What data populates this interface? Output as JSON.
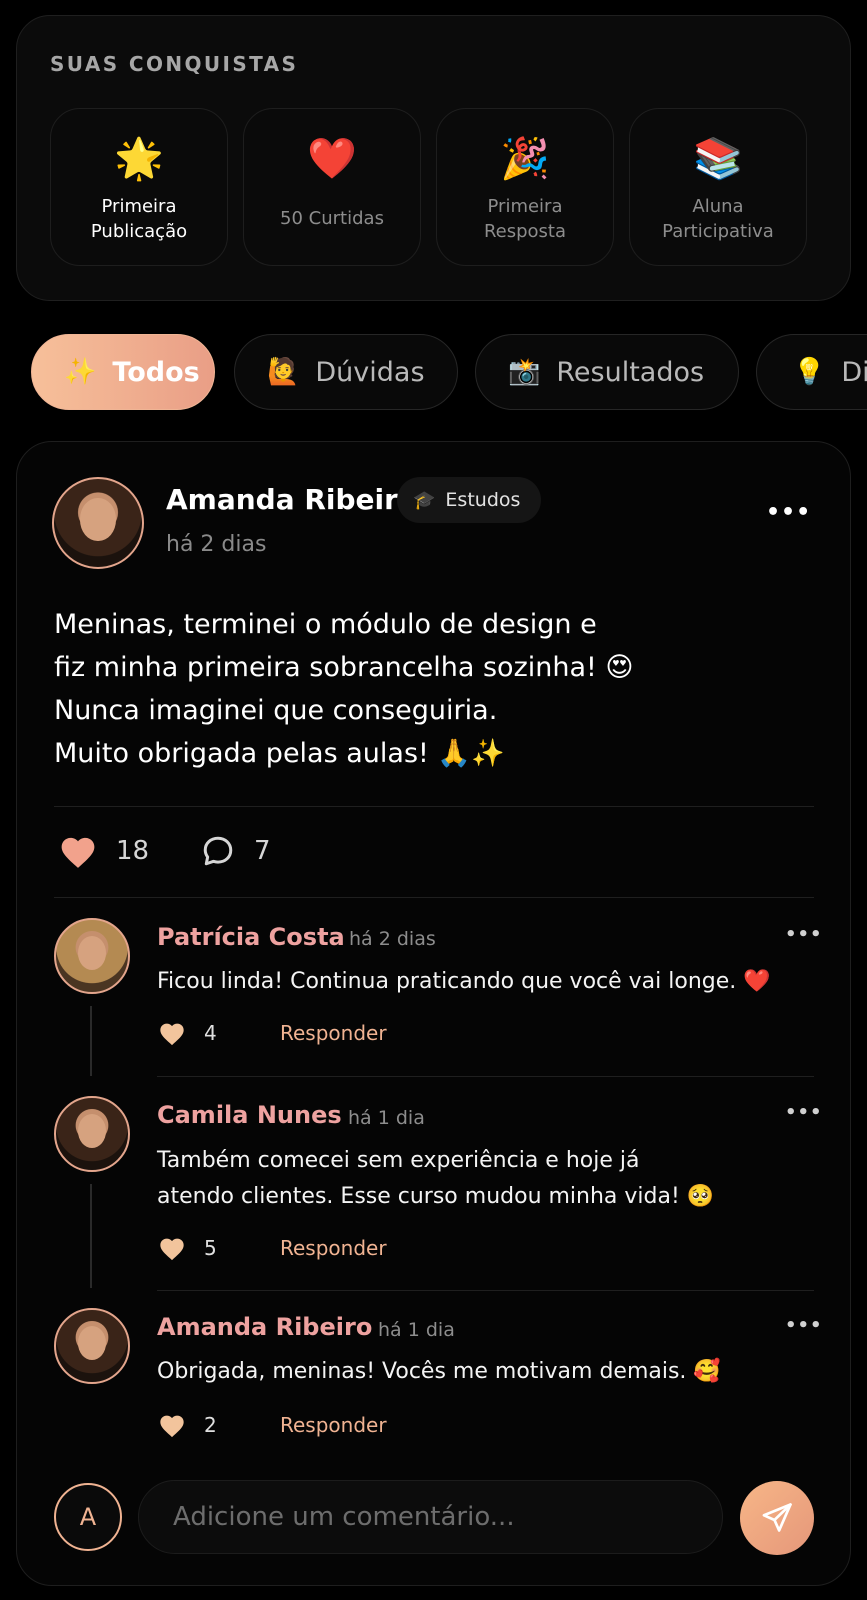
{
  "achievements": {
    "title": "SUAS CONQUISTAS",
    "items": [
      {
        "emoji": "🌟",
        "label": "Primeira Publicação",
        "unlocked": true
      },
      {
        "emoji": "❤️",
        "label": "50 Curtidas",
        "unlocked": false
      },
      {
        "emoji": "🎉",
        "label": "Primeira Resposta",
        "unlocked": false
      },
      {
        "emoji": "📚",
        "label": "Aluna Participativa",
        "unlocked": false
      }
    ]
  },
  "filters": [
    {
      "icon": "✨",
      "label": "Todos",
      "active": true
    },
    {
      "icon": "🙋",
      "label": "Dúvidas",
      "active": false
    },
    {
      "icon": "📸",
      "label": "Resultados",
      "active": false
    },
    {
      "icon": "💡",
      "label": "Di",
      "active": false
    }
  ],
  "post": {
    "author": "Amanda Ribeiro",
    "category_icon": "🎓",
    "category": "Estudos",
    "time": "há 2 dias",
    "lines": [
      "Meninas, terminei o módulo de design e",
      "fiz minha primeira sobrancelha sozinha! 😍",
      "Nunca imaginei que conseguiria.",
      "Muito obrigada pelas aulas! 🙏✨"
    ],
    "likes": "18",
    "comments": "7",
    "more": "•••"
  },
  "comments": [
    {
      "author": "Patrícia Costa",
      "time": "há 2 dias",
      "lines": [
        "Ficou linda! Continua praticando que você vai longe. ❤️"
      ],
      "likes": "4",
      "reply": "Responder",
      "more": "•••"
    },
    {
      "author": "Camila Nunes",
      "time": "há 1 dia",
      "lines": [
        "Também comecei sem experiência e hoje já",
        "atendo clientes. Esse curso mudou minha vida! 🥺"
      ],
      "likes": "5",
      "reply": "Responder",
      "more": "•••"
    },
    {
      "author": "Amanda Ribeiro",
      "time": "há 1 dia",
      "lines": [
        "Obrigada, meninas! Vocês me motivam demais. 🥰"
      ],
      "likes": "2",
      "reply": "Responder",
      "more": "•••"
    }
  ],
  "composer": {
    "avatar_initial": "A",
    "placeholder": "Adicione um comentário...",
    "send_icon": "paper-plane-icon"
  },
  "colors": {
    "accent": "#F0B392",
    "name_pink": "#EEA2A0",
    "heart": "#F2A28C",
    "heart_small": "#F2C49C"
  }
}
